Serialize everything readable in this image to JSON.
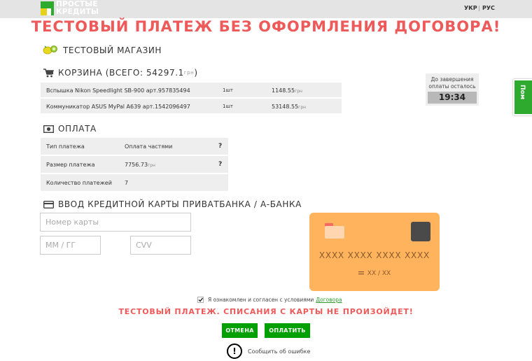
{
  "header": {
    "logo_line1": "ПРОСТЫЕ",
    "logo_line2": "КРЕДИТЫ",
    "lang_ukr": "УКР",
    "lang_sep": "|",
    "lang_rus": "РУС"
  },
  "title": "ТЕСТОВЫЙ ПЛАТЕЖ БЕЗ ОФОРМЛЕНИЯ ДОГОВОРА!",
  "shop": {
    "name": "ТЕСТОВЫЙ МАГАЗИН"
  },
  "cart": {
    "heading": "КОРЗИНА (ВСЕГО: 54297.1",
    "heading_currency": "грн",
    "heading_close": ")",
    "items": [
      {
        "name": "Вспышка Nikon Speedlight SB-900 арт.957835494",
        "qty": "1шт",
        "price": "1148.55",
        "currency": "грн"
      },
      {
        "name": "Коммуникатор ASUS MyPal A639 арт.1542096497",
        "qty": "1шт",
        "price": "53148.55",
        "currency": "грн"
      }
    ]
  },
  "timer": {
    "label": "До завершения оплаты осталось",
    "value": "19:34"
  },
  "side_tab": {
    "label": "Пом"
  },
  "payment": {
    "heading": "ОПЛАТА",
    "rows": [
      {
        "label": "Тип платежа",
        "value": "Оплата частями",
        "currency": "",
        "help": "?"
      },
      {
        "label": "Размер платежа",
        "value": "7756.73",
        "currency": "грн",
        "help": "?"
      },
      {
        "label": "Количество платежей",
        "value": "7",
        "currency": "",
        "help": ""
      }
    ]
  },
  "card_form": {
    "heading": "ВВОД КРЕДИТНОЙ КАРТЫ ПРИВАТБАНКА / А-БАНКА",
    "card_placeholder": "Номер карты",
    "expiry_placeholder": "ММ / ГГ",
    "cvv_placeholder": "CVV"
  },
  "card_preview": {
    "number": "XXXX  XXXX  XXXX  XXXX",
    "expiry": "XX  /  XX"
  },
  "agreement": {
    "text": "Я ознакомлен и согласен с условиями",
    "link": "Договора",
    "checked": true
  },
  "warning": "ТЕСТОВЫЙ ПЛАТЕЖ. СПИСАНИЯ С КАРТЫ НЕ ПРОИЗОЙДЕТ!",
  "buttons": {
    "cancel": "ОТМЕНА",
    "pay": "ОПЛАТИТЬ"
  },
  "report": {
    "icon": "!",
    "text": "Сообщить об ошибке"
  },
  "colors": {
    "accent_green": "#00a000",
    "warning_red": "#ee5a5a",
    "card_orange": "#ffb35c"
  }
}
